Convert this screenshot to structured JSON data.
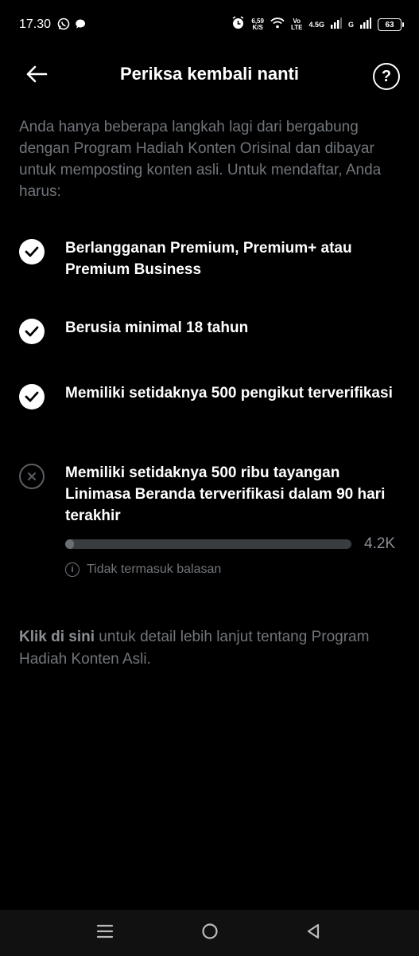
{
  "status_bar": {
    "time": "17.30",
    "speed_value": "6,59",
    "speed_unit": "K/S",
    "volte_top": "Vo",
    "volte_bottom": "LTE",
    "network": "4.5G",
    "network2": "G",
    "battery": "63",
    "icons": [
      "whatsapp-icon",
      "chat-icon",
      "alarm-icon",
      "wifi-icon",
      "signal-icon",
      "battery-icon"
    ]
  },
  "header": {
    "title": "Periksa kembali nanti",
    "back_icon": "arrow-left-icon",
    "help_icon": "question-mark-icon",
    "help_glyph": "?"
  },
  "intro": "Anda hanya beberapa langkah lagi dari bergabung dengan Program Hadiah Konten Orisinal dan dibayar untuk memposting konten asli. Untuk mendaftar, Anda harus:",
  "requirements": [
    {
      "text": "Berlangganan Premium, Premium+ atau Premium Business",
      "met": true,
      "icon": "check-circle-icon"
    },
    {
      "text": "Berusia minimal 18 tahun",
      "met": true,
      "icon": "check-circle-icon"
    },
    {
      "text": "Memiliki setidaknya 500 pengikut terverifikasi",
      "met": true,
      "icon": "check-circle-icon"
    },
    {
      "text": "Memiliki setidaknya 500 ribu tayangan Linimasa Beranda terverifikasi dalam 90 hari terakhir",
      "met": false,
      "icon": "x-circle-icon"
    }
  ],
  "progress": {
    "value_label": "4.2K",
    "fraction": 0.0084,
    "note": "Tidak termasuk balasan",
    "note_icon": "info-icon",
    "note_glyph": "i"
  },
  "footer": {
    "link_text": "Klik di sini",
    "rest_text": " untuk detail lebih lanjut tentang Program Hadiah Konten Asli."
  },
  "nav": {
    "icons": [
      "menu-icon",
      "home-circle-icon",
      "back-triangle-icon"
    ]
  }
}
